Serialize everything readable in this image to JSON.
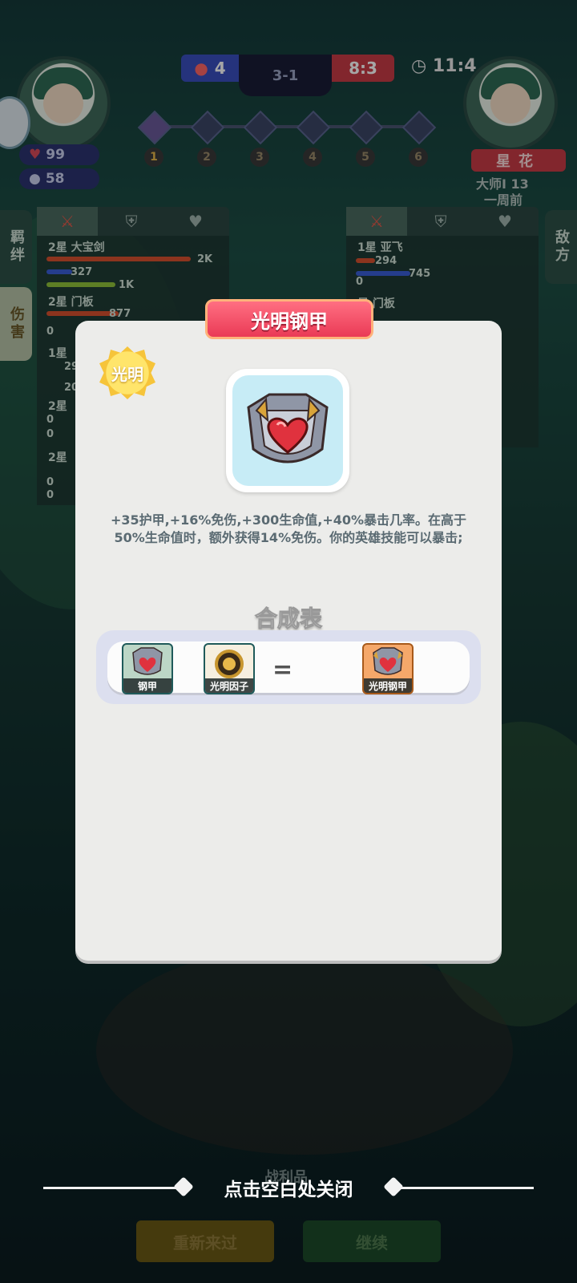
{
  "hud": {
    "score_left": "4",
    "round": "3-1",
    "score_right": "8:3",
    "timer": "11:4",
    "stage_numbers": [
      "1",
      "2",
      "3",
      "4",
      "5",
      "6"
    ],
    "player_hp": "99",
    "player_gold": "58",
    "enemy_name": "星花",
    "enemy_rank": "大师I 13",
    "enemy_time": "一周前",
    "left_tabs": [
      "羁绊",
      "伤害"
    ],
    "right_tab": "敌方",
    "left_stats": [
      {
        "label": "2星 大宝剑",
        "values": [
          "2K",
          "327",
          "1K"
        ]
      },
      {
        "label": "2星 门板",
        "values": [
          "877",
          "0"
        ]
      },
      {
        "label": "1星",
        "values": [
          "29",
          "20"
        ]
      },
      {
        "label": "2星",
        "values": [
          "0",
          "0"
        ]
      },
      {
        "label": "2星",
        "values": [
          "0",
          "0"
        ]
      }
    ],
    "right_stats": [
      {
        "label": "1星 亚飞",
        "values": [
          "294",
          "0",
          "745"
        ]
      },
      {
        "label": "星 门板",
        "values": []
      }
    ]
  },
  "modal": {
    "title": "光明钢甲",
    "badge": "光明",
    "item_icon": "armor-icon",
    "description": "+35护甲,+16%免伤,+300生命值,+40%暴击几率。在高于50%生命值时，额外获得14%免伤。你的英雄技能可以暴击;",
    "combo_title": "合成表",
    "combo": {
      "ingredient_1": "钢甲",
      "ingredient_2": "光明因子",
      "equals": "=",
      "result": "光明钢甲"
    }
  },
  "close_hint": "点击空白处关闭",
  "buttons": {
    "retry": "重新来过",
    "continue": "继续",
    "behind_label": "战利品"
  },
  "colors": {
    "title_banner": "#ea3a56",
    "badge": "#f6c43a",
    "item_bg": "#c7ecf6"
  }
}
